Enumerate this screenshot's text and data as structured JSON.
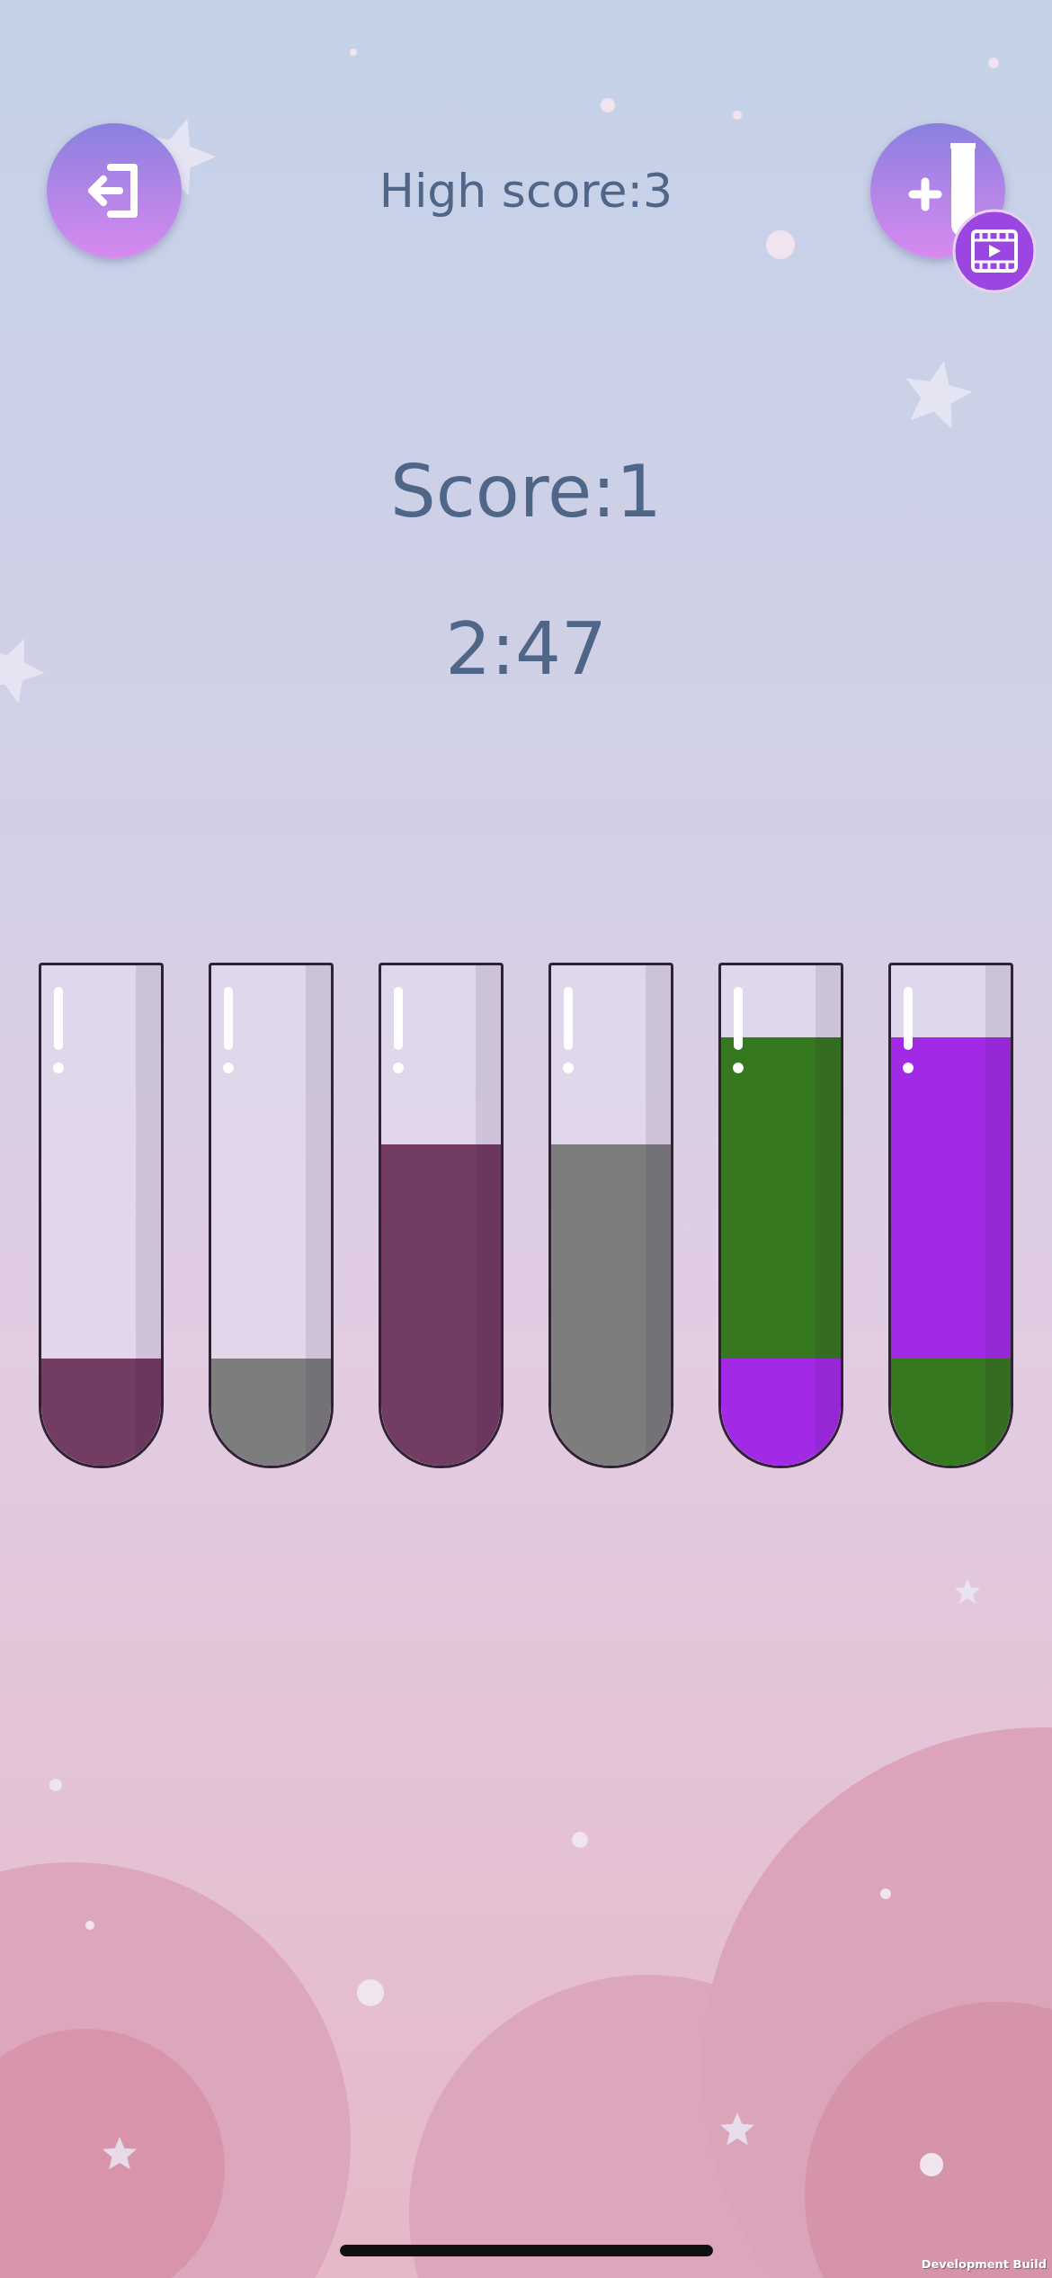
{
  "header": {
    "high_score": "High score:3"
  },
  "score": "Score:1",
  "timer": "2:47",
  "tubes": [
    {
      "layers": [
        {
          "color": "#733c63"
        }
      ]
    },
    {
      "layers": [
        {
          "color": "#7d7d7d"
        }
      ]
    },
    {
      "layers": [
        {
          "color": "#733c63"
        },
        {
          "color": "#733c63"
        },
        {
          "color": "#733c63"
        }
      ]
    },
    {
      "layers": [
        {
          "color": "#7d7d7d"
        },
        {
          "color": "#7d7d7d"
        },
        {
          "color": "#7d7d7d"
        }
      ]
    },
    {
      "layers": [
        {
          "color": "#a22ae6"
        },
        {
          "color": "#367820"
        },
        {
          "color": "#367820"
        },
        {
          "color": "#367820"
        }
      ]
    },
    {
      "layers": [
        {
          "color": "#367820"
        },
        {
          "color": "#a22ae6"
        },
        {
          "color": "#a22ae6"
        },
        {
          "color": "#a22ae6"
        }
      ]
    }
  ],
  "build_label": "Development Build"
}
